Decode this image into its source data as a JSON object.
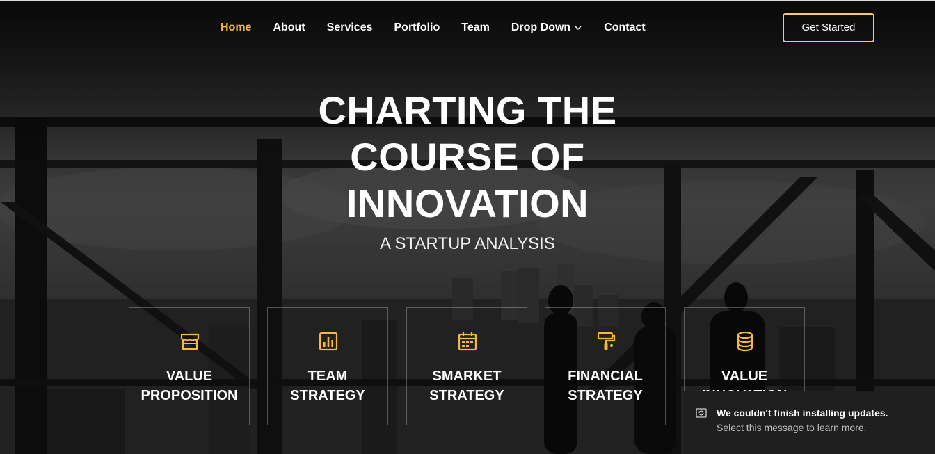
{
  "nav": {
    "items": [
      {
        "label": "Home",
        "active": true
      },
      {
        "label": "About"
      },
      {
        "label": "Services"
      },
      {
        "label": "Portfolio"
      },
      {
        "label": "Team"
      },
      {
        "label": "Drop Down",
        "has_dropdown": true
      },
      {
        "label": "Contact"
      }
    ],
    "cta_label": "Get Started"
  },
  "hero": {
    "title_line1": "CHARTING THE",
    "title_line2": "COURSE OF",
    "title_line3": "INNOVATION",
    "subtitle": "A STARTUP ANALYSIS"
  },
  "features": [
    {
      "icon": "storefront-icon",
      "label": "VALUE\nPROPOSITION"
    },
    {
      "icon": "bar-chart-icon",
      "label": "TEAM\nSTRATEGY"
    },
    {
      "icon": "calendar-icon",
      "label": "SMARKET\nSTRATEGY"
    },
    {
      "icon": "paint-roller-icon",
      "label": "FINANCIAL\nSTRATEGY"
    },
    {
      "icon": "database-icon",
      "label": "VALUE\nINNOVATION"
    }
  ],
  "toast": {
    "icon": "update-icon",
    "title": "We couldn't finish installing updates.",
    "text": "Select this message to learn more."
  },
  "colors": {
    "accent": "#f6b93b",
    "button_border": "#f6c76d",
    "text": "#ffffff",
    "toast_bg": "#1f1f1f"
  }
}
